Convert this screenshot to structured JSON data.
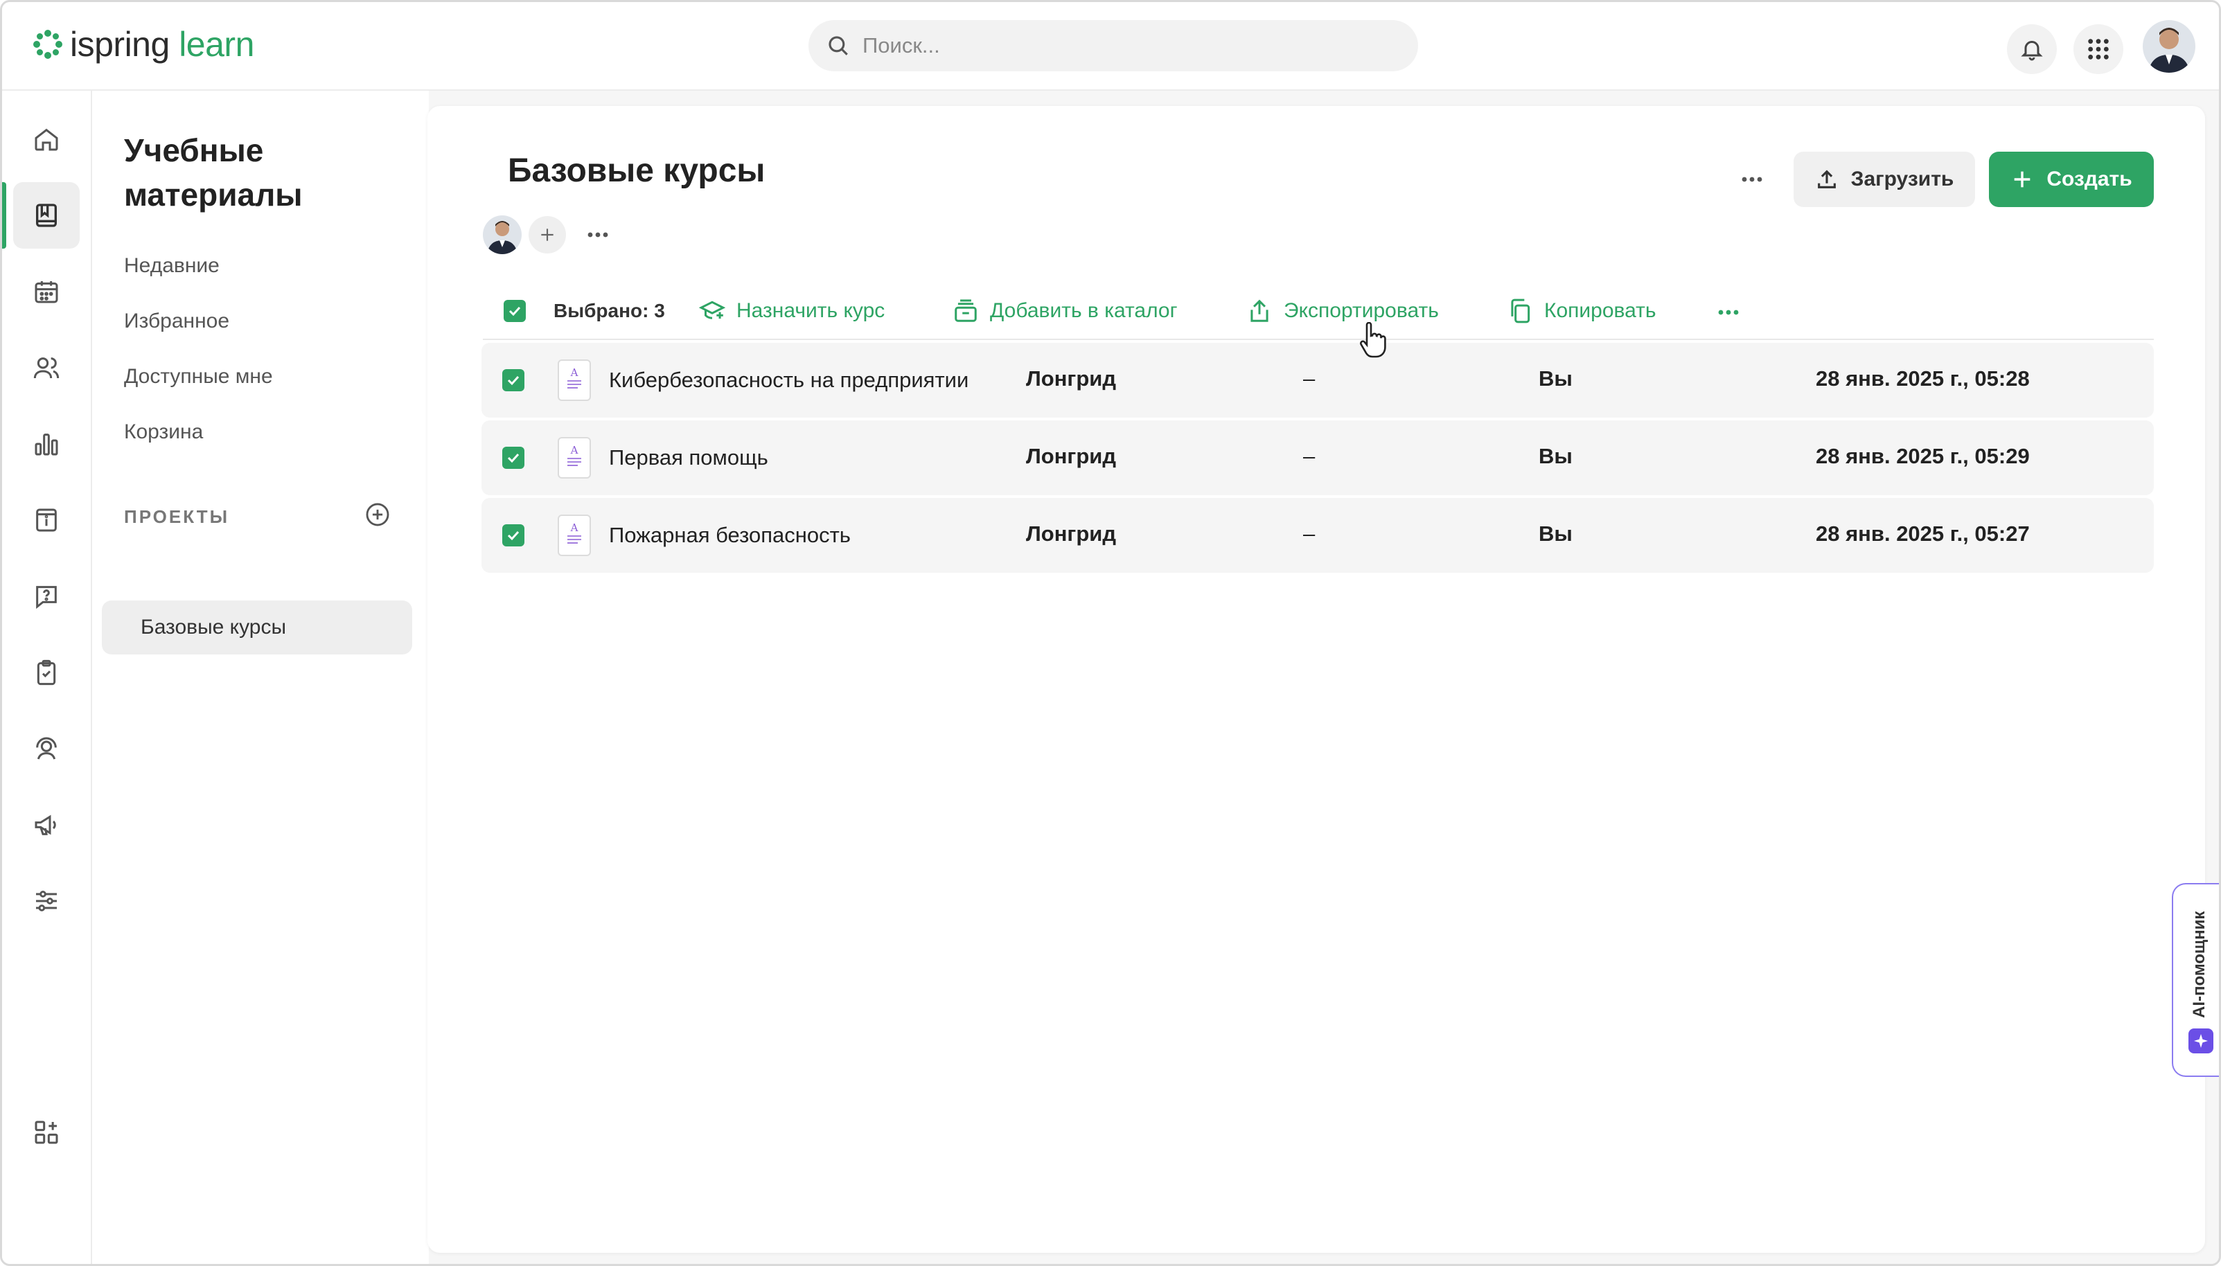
{
  "app": {
    "logo_brand": "ispring",
    "logo_product": "learn",
    "brand_color": "#2ea464"
  },
  "topbar": {
    "search_placeholder": "Поиск...",
    "icons": [
      "search-icon",
      "bell-icon",
      "apps-grid-icon",
      "user-avatar"
    ]
  },
  "rail": {
    "items": [
      {
        "icon": "home-icon",
        "active": false
      },
      {
        "icon": "book-icon",
        "active": true
      },
      {
        "icon": "calendar-icon",
        "active": false
      },
      {
        "icon": "users-icon",
        "active": false
      },
      {
        "icon": "bar-chart-icon",
        "active": false
      },
      {
        "icon": "info-board-icon",
        "active": false
      },
      {
        "icon": "question-chat-icon",
        "active": false
      },
      {
        "icon": "clipboard-check-icon",
        "active": false
      },
      {
        "icon": "support-agent-icon",
        "active": false
      },
      {
        "icon": "megaphone-icon",
        "active": false
      },
      {
        "icon": "sliders-icon",
        "active": false
      },
      {
        "icon": "add-widget-icon",
        "active": false
      }
    ]
  },
  "sidebar": {
    "title": "Учебные материалы",
    "links": [
      "Недавние",
      "Избранное",
      "Доступные мне",
      "Корзина"
    ],
    "projects_label": "ПРОЕКТЫ",
    "projects": [
      {
        "label": "Базовые курсы",
        "active": true
      }
    ]
  },
  "main": {
    "title": "Базовые курсы",
    "upload_label": "Загрузить",
    "create_label": "Создать",
    "selection": {
      "count_label": "Выбрано: 3",
      "actions": [
        {
          "label": "Назначить курс",
          "icon": "assign-course-icon"
        },
        {
          "label": "Добавить в каталог",
          "icon": "catalog-add-icon"
        },
        {
          "label": "Экспортировать",
          "icon": "export-icon"
        },
        {
          "label": "Копировать",
          "icon": "copy-icon"
        }
      ]
    },
    "rows": [
      {
        "name": "Кибербезопасность на предприятии",
        "type": "Лонгрид",
        "dash": "–",
        "author": "Вы",
        "date": "28 янв. 2025 г., 05:28",
        "checked": true
      },
      {
        "name": "Первая помощь",
        "type": "Лонгрид",
        "dash": "–",
        "author": "Вы",
        "date": "28 янв. 2025 г., 05:29",
        "checked": true
      },
      {
        "name": "Пожарная безопасность",
        "type": "Лонгрид",
        "dash": "–",
        "author": "Вы",
        "date": "28 янв. 2025 г., 05:27",
        "checked": true
      }
    ]
  },
  "ai": {
    "label": "AI-помощник",
    "accent": "#6b4fe6"
  }
}
